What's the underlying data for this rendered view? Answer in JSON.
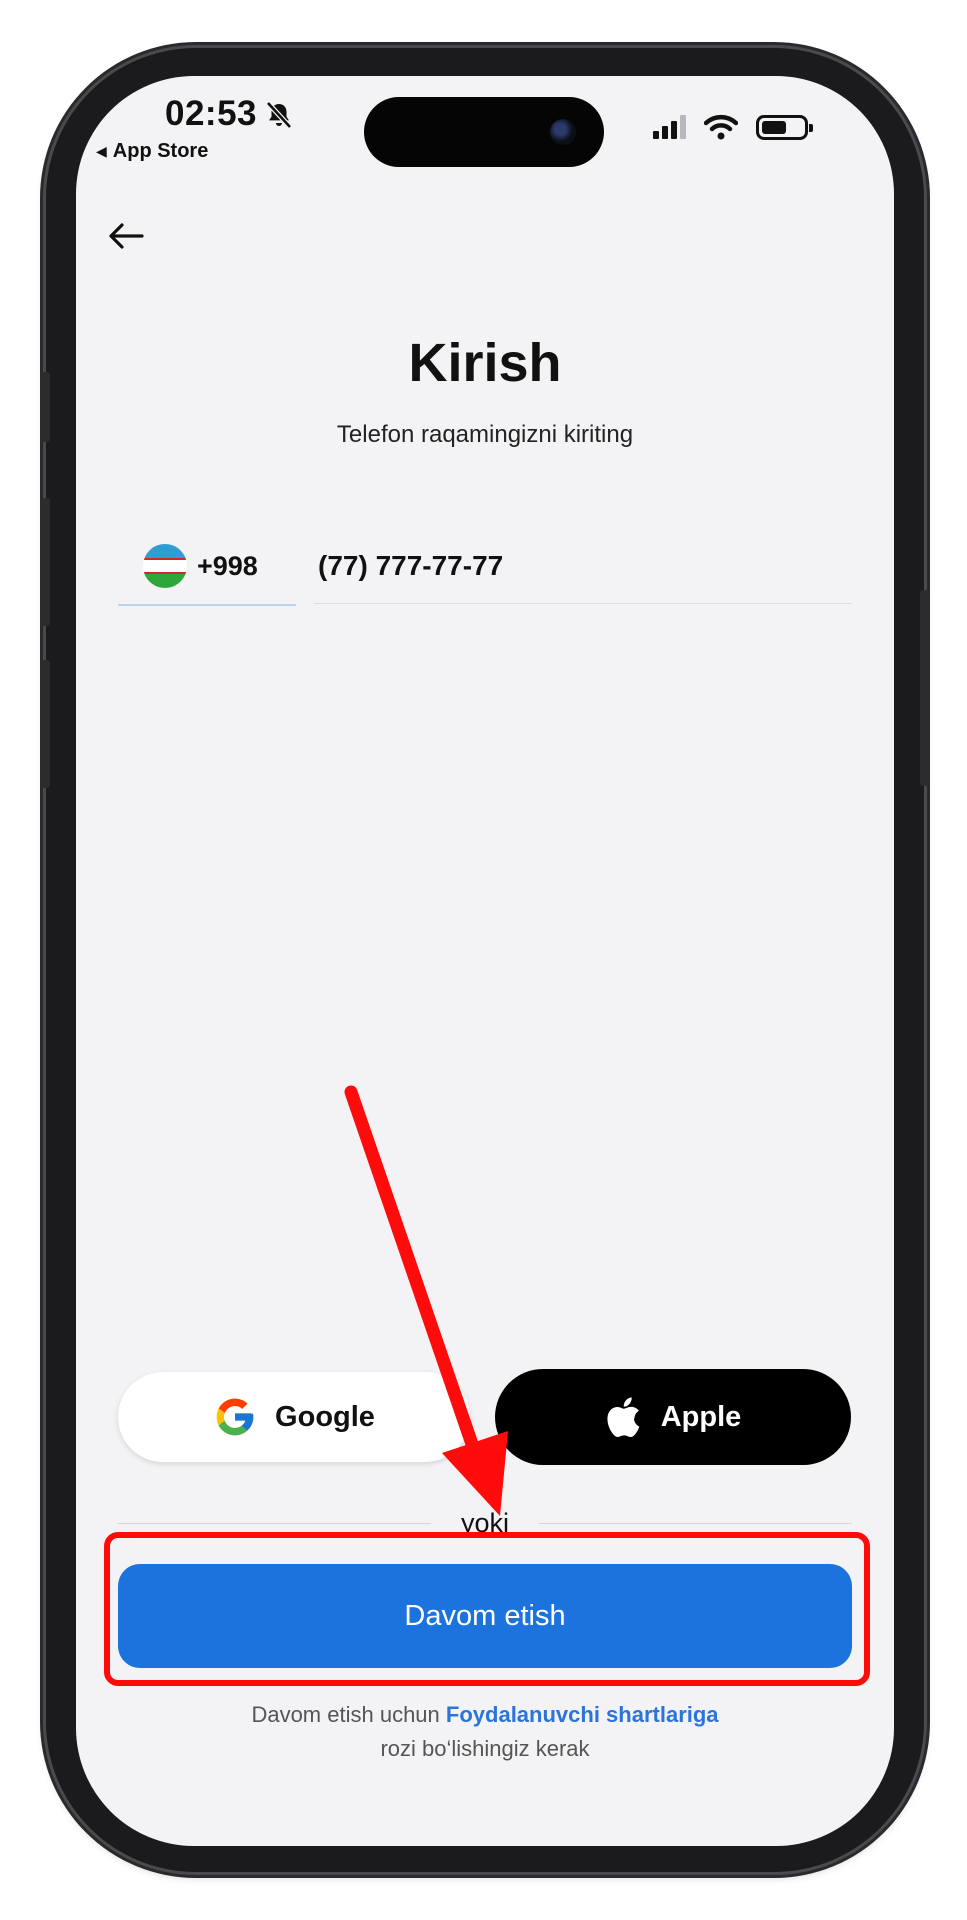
{
  "status_bar": {
    "time": "02:53",
    "back_to_app": "App Store"
  },
  "header": {
    "title": "Kirish",
    "subtitle": "Telefon raqamingizni kiriting"
  },
  "phone_form": {
    "country_dial_code": "+998",
    "phone_value": "(77) 777-77-77"
  },
  "social_login": {
    "google_label": "Google",
    "apple_label": "Apple",
    "divider_text": "yoki"
  },
  "actions": {
    "continue_label": "Davom etish"
  },
  "terms": {
    "prefix": "Davom etish uchun",
    "link_text": "Foydalanuvchi shartlariga",
    "suffix": "rozi bo‘lishingiz kerak"
  },
  "colors": {
    "primary": "#1d73dd",
    "annotation": "#ff0b0b",
    "screen_background": "#f3f3f6"
  },
  "icons": {
    "flag": "uzbekistan-flag-icon",
    "google": "google-g-icon",
    "apple": "apple-logo-icon",
    "back": "arrow-left-icon"
  }
}
